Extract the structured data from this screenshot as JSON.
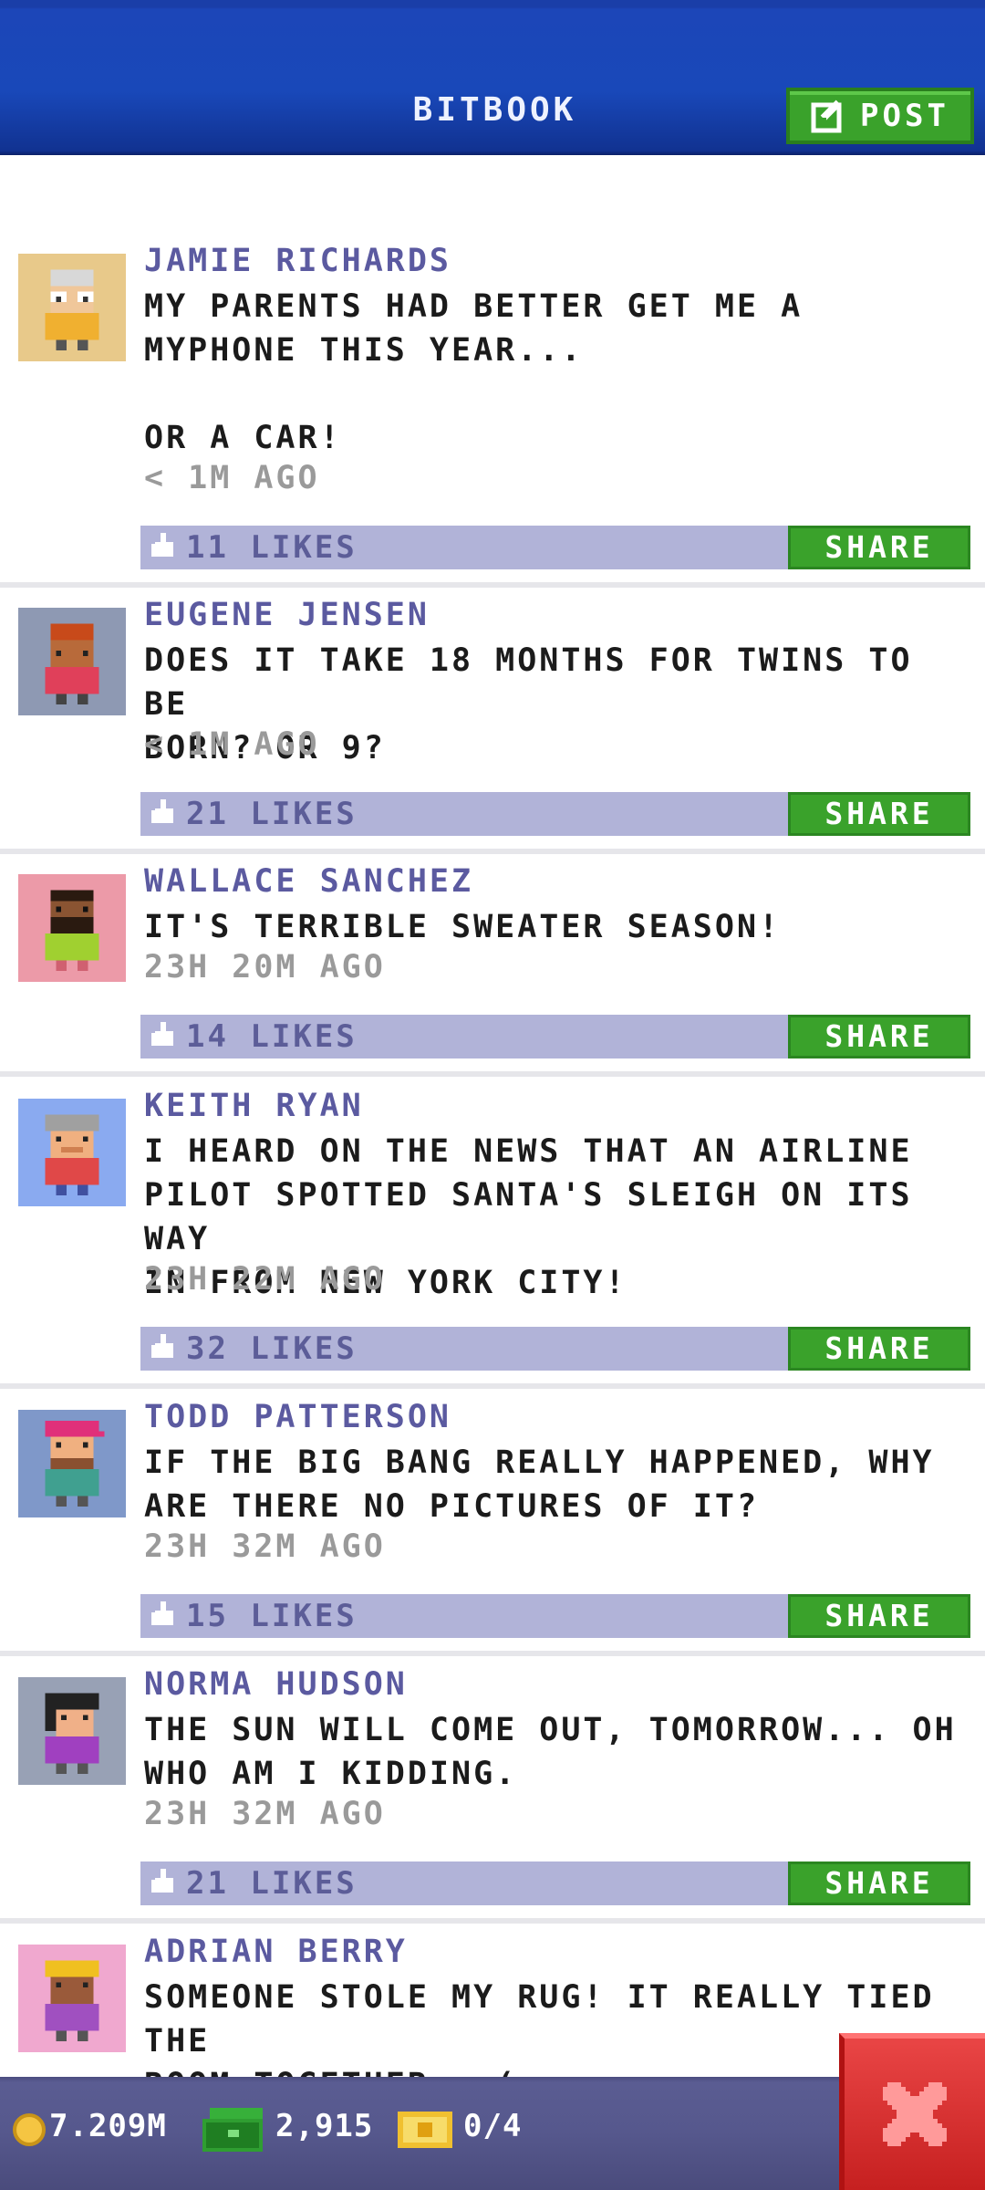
{
  "header": {
    "title": "BITBOOK",
    "post_label": "POST"
  },
  "posts": [
    {
      "name": "JAMIE RICHARDS",
      "text": "MY PARENTS HAD BETTER GET ME A\nMYPHONE THIS YEAR...\n\nOR A CAR!",
      "time": "< 1M AGO",
      "likes": "11 LIKES",
      "share": "SHARE",
      "avatar_bg": "#e8c98a"
    },
    {
      "name": "EUGENE JENSEN",
      "text": "DOES IT TAKE 18 MONTHS FOR TWINS TO BE\nBORN? OR 9?",
      "time": "< 1M AGO",
      "likes": "21 LIKES",
      "share": "SHARE",
      "avatar_bg": "#8e99b3"
    },
    {
      "name": "WALLACE SANCHEZ",
      "text": "IT'S TERRIBLE SWEATER SEASON!",
      "time": "23H 20M AGO",
      "likes": "14 LIKES",
      "share": "SHARE",
      "avatar_bg": "#ec9aa8"
    },
    {
      "name": "KEITH RYAN",
      "text": "I HEARD ON THE NEWS THAT AN AIRLINE\nPILOT SPOTTED SANTA'S SLEIGH ON ITS WAY\nIN FROM NEW YORK CITY!",
      "time": "23H 22M AGO",
      "likes": "32 LIKES",
      "share": "SHARE",
      "avatar_bg": "#8aaaf0"
    },
    {
      "name": "TODD PATTERSON",
      "text": "IF THE BIG BANG REALLY HAPPENED, WHY\nARE THERE NO PICTURES OF IT?",
      "time": "23H 32M AGO",
      "likes": "15 LIKES",
      "share": "SHARE",
      "avatar_bg": "#7f98c9"
    },
    {
      "name": "NORMA HUDSON",
      "text": "THE SUN WILL COME OUT, TOMORROW... OH\nWHO AM I KIDDING.",
      "time": "23H 32M AGO",
      "likes": "21 LIKES",
      "share": "SHARE",
      "avatar_bg": "#98a1b5"
    },
    {
      "name": "ADRIAN BERRY",
      "text": "SOMEONE STOLE MY RUG! IT REALLY TIED THE\nROOM TOGETHER. :(",
      "time": "",
      "likes": "",
      "share": "",
      "avatar_bg": "#f0a8cf"
    }
  ],
  "footer": {
    "coins": "7.209M",
    "bux": "2,915",
    "tickets": "0/4"
  },
  "colors": {
    "header_blue": "#1948b9",
    "name_purple": "#5b5aa0",
    "share_green": "#3aa22b",
    "like_bar": "#b1b3d8",
    "close_red": "#d92f2f"
  }
}
